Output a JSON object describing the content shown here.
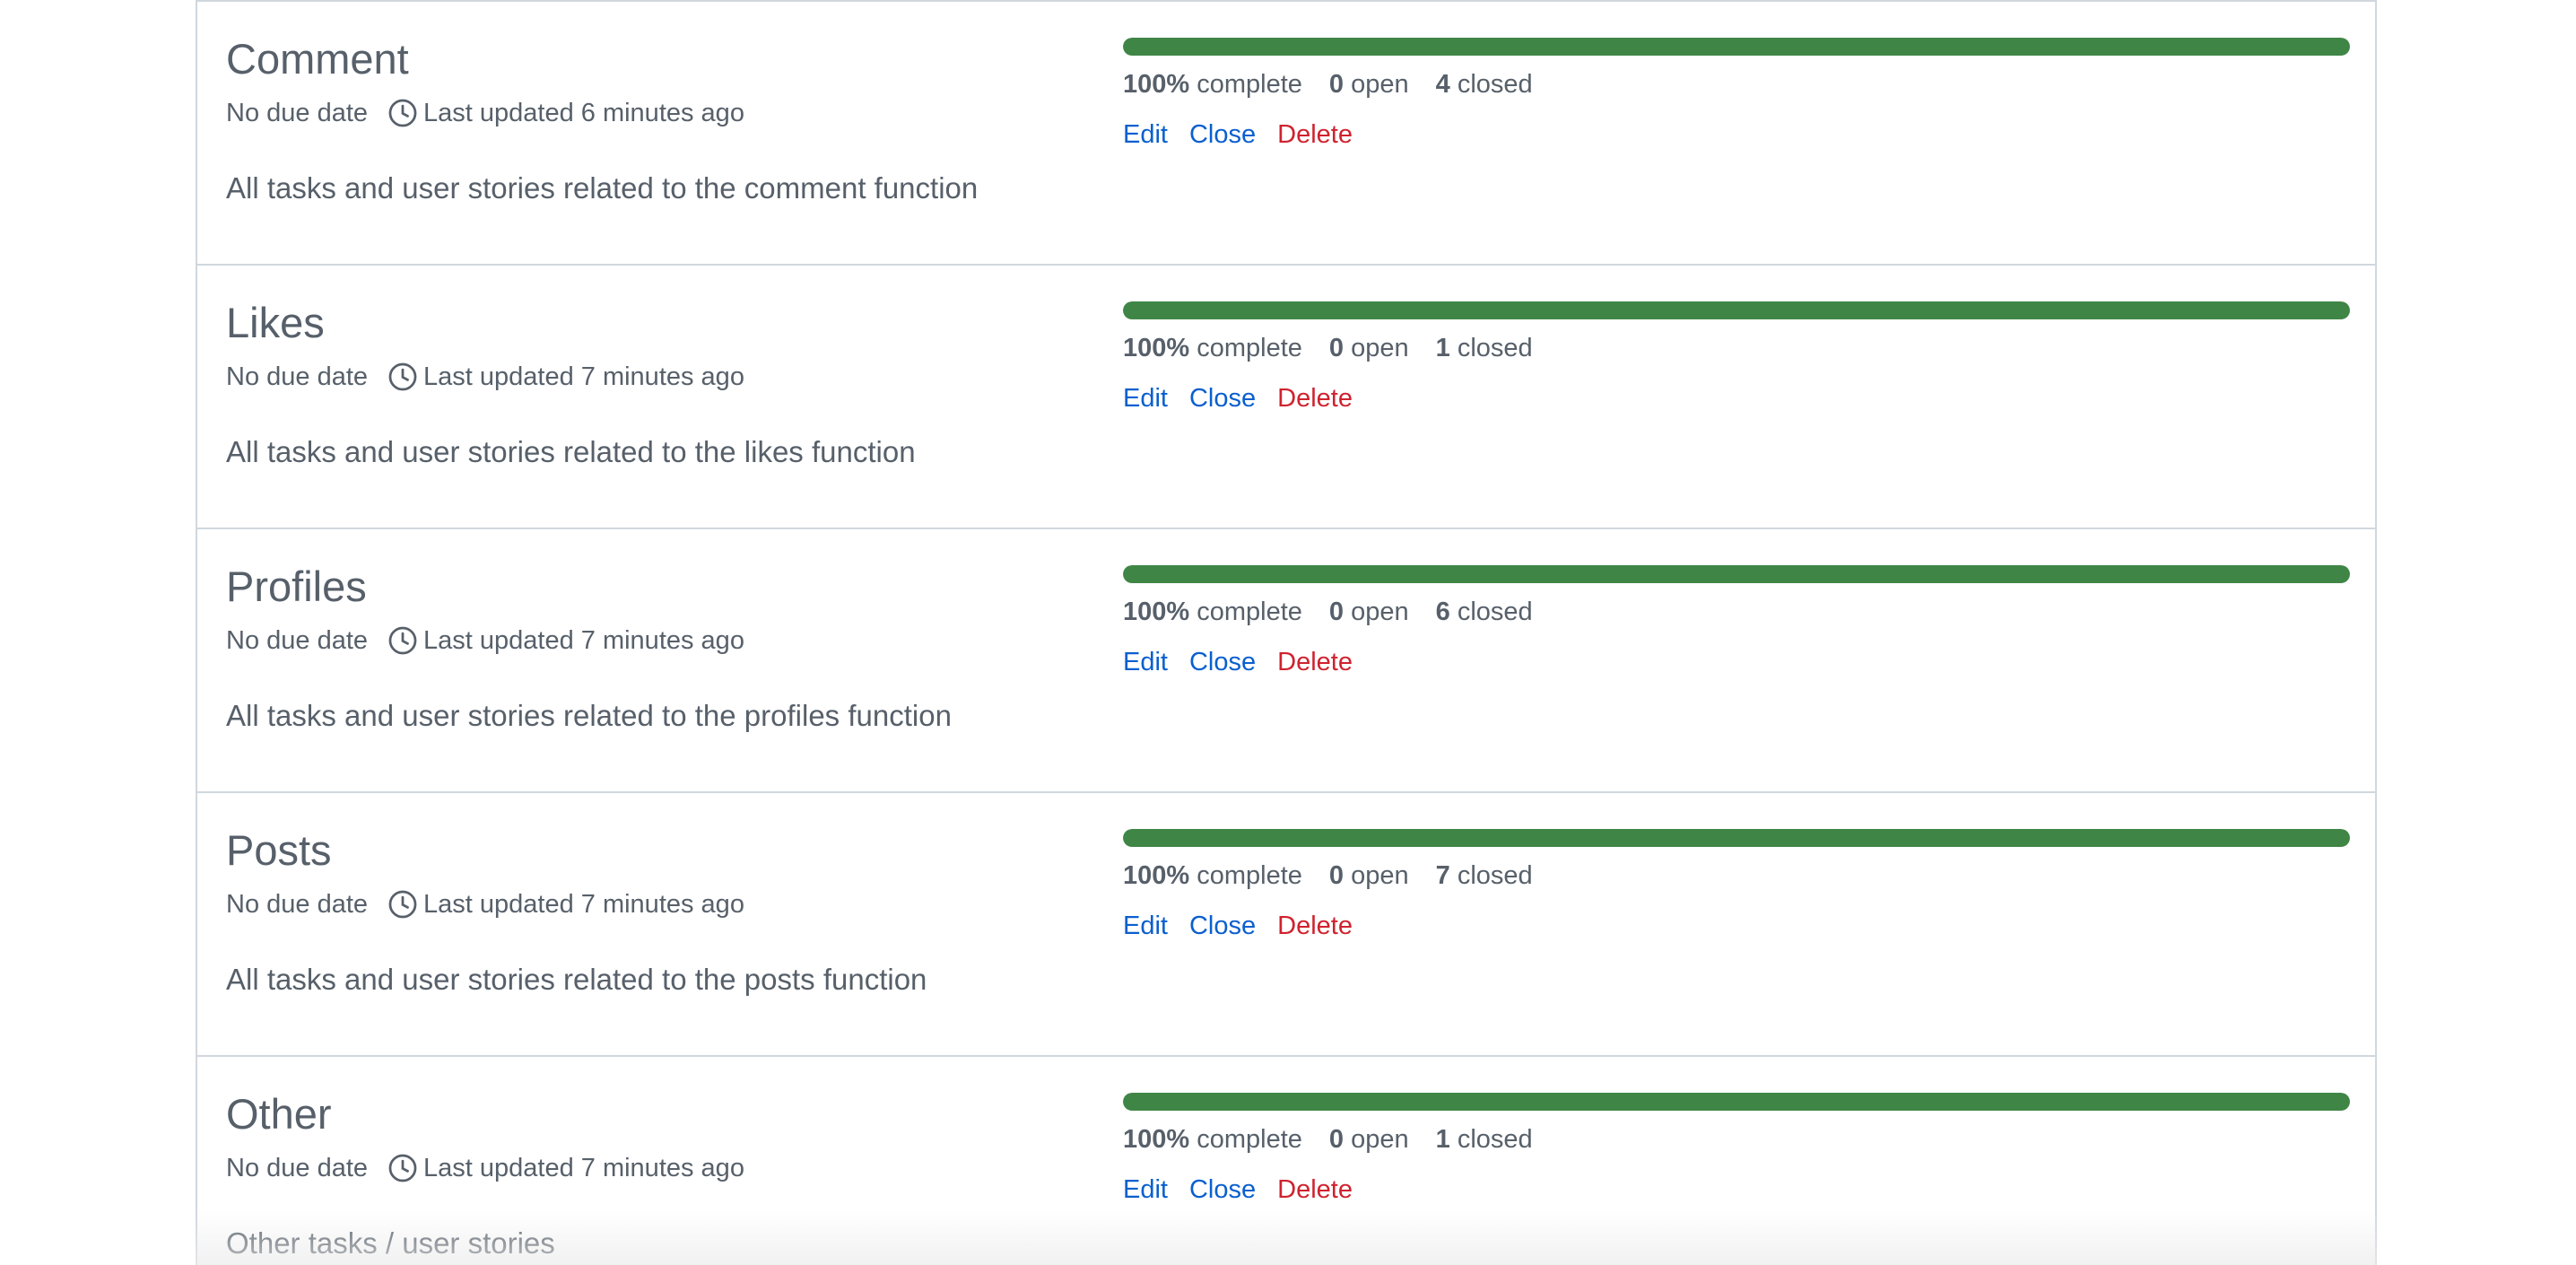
{
  "milestones": [
    {
      "title": "Comment",
      "due": "No due date",
      "updated": "Last updated 6 minutes ago",
      "description": "All tasks and user stories related to the comment function",
      "progress_fraction": 1.0,
      "percent": "100%",
      "complete_label": "complete",
      "open_count": "0",
      "open_label": "open",
      "closed_count": "4",
      "closed_label": "closed",
      "edit_label": "Edit",
      "close_label": "Close",
      "delete_label": "Delete"
    },
    {
      "title": "Likes",
      "due": "No due date",
      "updated": "Last updated 7 minutes ago",
      "description": "All tasks and user stories related to the likes function",
      "progress_fraction": 1.0,
      "percent": "100%",
      "complete_label": "complete",
      "open_count": "0",
      "open_label": "open",
      "closed_count": "1",
      "closed_label": "closed",
      "edit_label": "Edit",
      "close_label": "Close",
      "delete_label": "Delete"
    },
    {
      "title": "Profiles",
      "due": "No due date",
      "updated": "Last updated 7 minutes ago",
      "description": "All tasks and user stories related to the profiles function",
      "progress_fraction": 1.0,
      "percent": "100%",
      "complete_label": "complete",
      "open_count": "0",
      "open_label": "open",
      "closed_count": "6",
      "closed_label": "closed",
      "edit_label": "Edit",
      "close_label": "Close",
      "delete_label": "Delete"
    },
    {
      "title": "Posts",
      "due": "No due date",
      "updated": "Last updated 7 minutes ago",
      "description": "All tasks and user stories related to the posts function",
      "progress_fraction": 1.0,
      "percent": "100%",
      "complete_label": "complete",
      "open_count": "0",
      "open_label": "open",
      "closed_count": "7",
      "closed_label": "closed",
      "edit_label": "Edit",
      "close_label": "Close",
      "delete_label": "Delete"
    },
    {
      "title": "Other",
      "due": "No due date",
      "updated": "Last updated 7 minutes ago",
      "description": "Other tasks / user stories",
      "progress_fraction": 1.0,
      "percent": "100%",
      "complete_label": "complete",
      "open_count": "0",
      "open_label": "open",
      "closed_count": "1",
      "closed_label": "closed",
      "edit_label": "Edit",
      "close_label": "Close",
      "delete_label": "Delete"
    }
  ],
  "colors": {
    "progress": "#3f8646",
    "link": "#0a5fcf",
    "danger": "#cf222e",
    "text_muted": "#57606a",
    "border": "#d0d7de"
  },
  "icons": {
    "updated": "clock-icon"
  }
}
